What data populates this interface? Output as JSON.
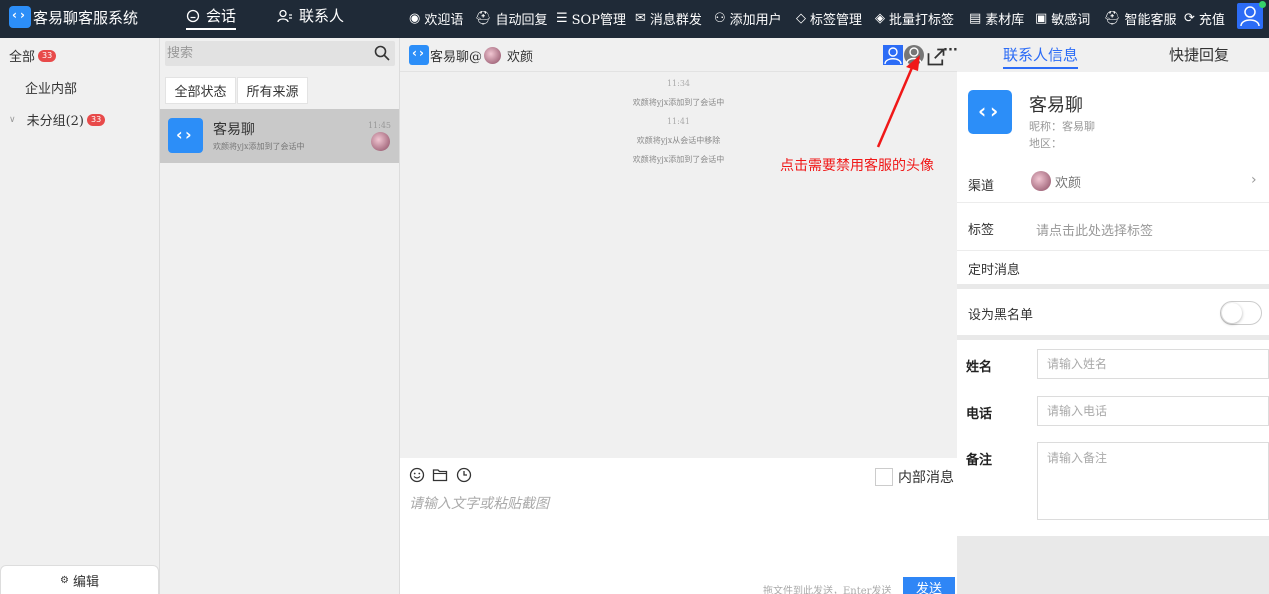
{
  "app": {
    "title": "客易聊客服系统"
  },
  "nav": {
    "tabs": [
      {
        "label": "会话"
      },
      {
        "label": "联系人"
      }
    ]
  },
  "toolbar": {
    "items": [
      {
        "label": "欢迎语",
        "icon": "chat-bubble-icon"
      },
      {
        "label": "自动回复",
        "icon": "robot-icon"
      },
      {
        "label": "SOP管理",
        "icon": "list-icon"
      },
      {
        "label": "消息群发",
        "icon": "broadcast-icon"
      },
      {
        "label": "添加用户",
        "icon": "add-user-icon"
      },
      {
        "label": "标签管理",
        "icon": "tag-icon"
      },
      {
        "label": "批量打标签",
        "icon": "tags-icon"
      },
      {
        "label": "素材库",
        "icon": "library-icon"
      },
      {
        "label": "敏感词",
        "icon": "alert-icon"
      },
      {
        "label": "智能客服",
        "icon": "robot-icon"
      },
      {
        "label": "充值",
        "icon": "recharge-icon"
      }
    ]
  },
  "groups": {
    "all_label": "全部",
    "all_count": "33",
    "internal_label": "企业内部",
    "ungrouped_label": "未分组(2)",
    "ungrouped_count": "33",
    "edit_label": "编辑"
  },
  "sessions": {
    "search_placeholder": "搜索",
    "filter_status": "全部状态",
    "filter_source": "所有来源",
    "items": [
      {
        "name": "客易聊",
        "preview": "欢颜将yjx添加到了会话中",
        "time": "11:45"
      }
    ]
  },
  "chat": {
    "title_a": "客易聊@",
    "title_b": "欢颜",
    "messages": [
      {
        "type": "time",
        "text": "11:34"
      },
      {
        "type": "system",
        "text": "欢颜将yjx添加到了会话中"
      },
      {
        "type": "time",
        "text": "11:41"
      },
      {
        "type": "system",
        "text": "欢颜将yjx从会话中移除"
      },
      {
        "type": "system",
        "text": "欢颜将yjx添加到了会话中"
      }
    ],
    "annotation": "点击需要禁用客服的头像",
    "annotation_color": "#f01818",
    "internal_label": "内部消息",
    "input_placeholder": "请输入文字或粘贴截图",
    "hint": "拖文件到此发送，Enter发送",
    "send_label": "发送"
  },
  "contact": {
    "tab_info": "联系人信息",
    "tab_quick": "快捷回复",
    "name": "客易聊",
    "nickname": "昵称：客易聊",
    "region": "地区：",
    "channel_label": "渠道",
    "channel_value": "欢颜",
    "tag_label": "标签",
    "tag_placeholder": "请点击此处选择标签",
    "scheduled_label": "定时消息",
    "blacklist_label": "设为黑名单",
    "blacklist_on": false,
    "form": {
      "name_label": "姓名",
      "name_placeholder": "请输入姓名",
      "phone_label": "电话",
      "phone_placeholder": "请输入电话",
      "note_label": "备注",
      "note_placeholder": "请输入备注"
    }
  },
  "colors": {
    "accent": "#2c6cf6",
    "brand": "#2c8ef8",
    "topbar": "#1f2a37",
    "badge": "#e84a4a"
  }
}
